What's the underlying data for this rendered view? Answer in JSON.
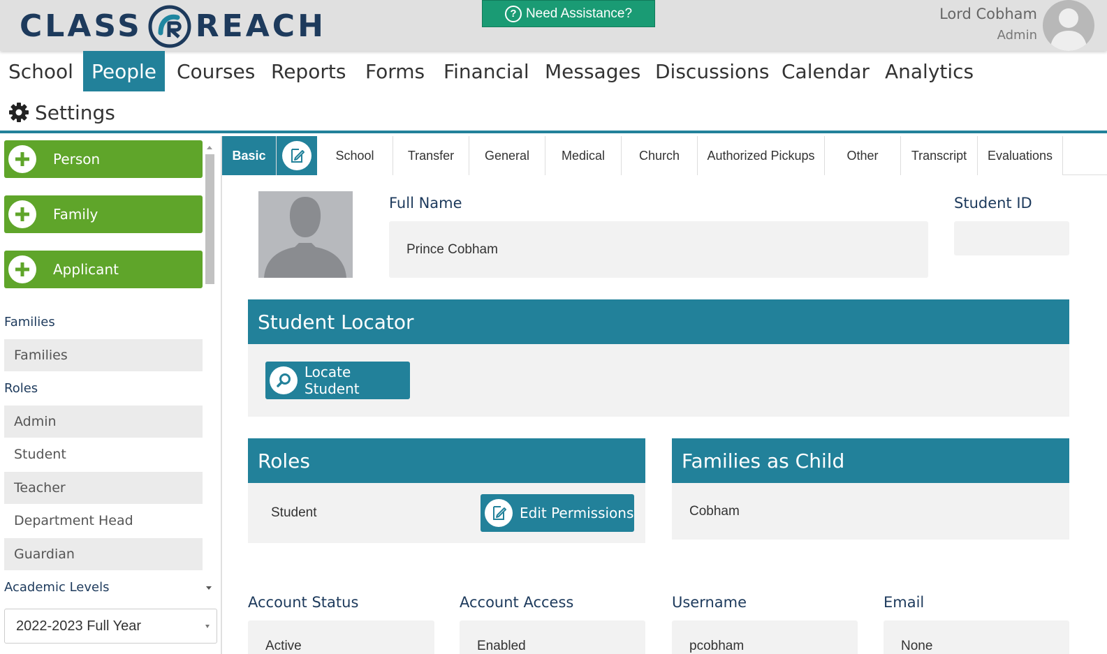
{
  "header": {
    "logo_left": "CLASS",
    "logo_right": "REACH",
    "assist_label": "Need Assistance?",
    "user_name": "Lord Cobham",
    "user_role": "Admin"
  },
  "nav": {
    "items": [
      "School",
      "People",
      "Courses",
      "Reports",
      "Forms",
      "Financial",
      "Messages",
      "Discussions",
      "Calendar",
      "Analytics"
    ],
    "active": "People",
    "settings": "Settings"
  },
  "sidebar": {
    "add_buttons": [
      "Person",
      "Family",
      "Applicant"
    ],
    "families_heading": "Families",
    "families_items": [
      "Families"
    ],
    "roles_heading": "Roles",
    "roles_items": [
      "Admin",
      "Student",
      "Teacher",
      "Department Head",
      "Guardian"
    ],
    "levels_heading": "Academic Levels",
    "year_select": "2022-2023 Full Year"
  },
  "tabs": [
    "Basic",
    "School",
    "Transfer",
    "General",
    "Medical",
    "Church",
    "Authorized Pickups",
    "Other",
    "Transcript",
    "Evaluations"
  ],
  "profile": {
    "full_name_label": "Full Name",
    "full_name": "Prince Cobham",
    "student_id_label": "Student ID",
    "student_id": ""
  },
  "locator": {
    "title": "Student Locator",
    "button": "Locate Student"
  },
  "roles_panel": {
    "title": "Roles",
    "role": "Student",
    "button": "Edit Permissions"
  },
  "families_panel": {
    "title": "Families as Child",
    "family": "Cobham"
  },
  "account": {
    "status_label": "Account Status",
    "status": "Active",
    "access_label": "Account Access",
    "access": "Enabled",
    "username_label": "Username",
    "username": "pcobham",
    "email_label": "Email",
    "email": "None"
  },
  "colors": {
    "teal": "#22819a",
    "green": "#5fa52a",
    "assist_green": "#1a9b74",
    "navy": "#1d3a5c"
  }
}
